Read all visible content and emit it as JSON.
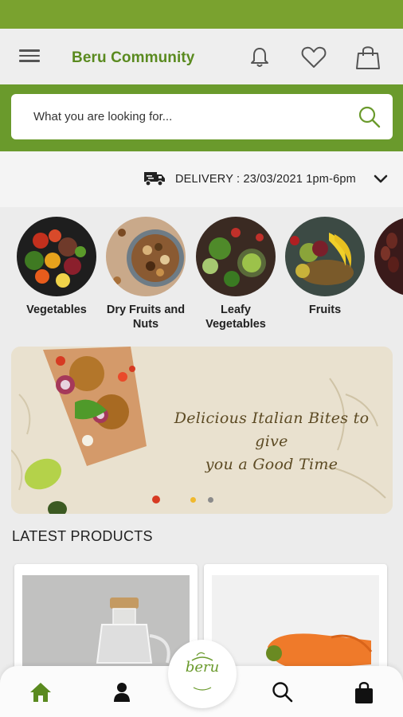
{
  "header": {
    "title": "Beru Community",
    "icons": [
      "menu-icon",
      "bell-icon",
      "heart-icon",
      "bag-icon"
    ]
  },
  "search": {
    "placeholder": "What you are looking for..."
  },
  "delivery": {
    "text": "DELIVERY : 23/03/2021 1pm-6pm"
  },
  "categories": [
    {
      "label": "Vegetables"
    },
    {
      "label": "Dry Fruits and Nuts"
    },
    {
      "label": "Leafy Vegetables"
    },
    {
      "label": "Fruits"
    }
  ],
  "banner": {
    "line1": "Delicious Italian Bites to give",
    "line2": "you a Good Time",
    "page_count": 2,
    "active_page": 1
  },
  "latest": {
    "title": "LATEST PRODUCTS"
  },
  "bottom_nav": {
    "items": [
      "home",
      "profile",
      "search",
      "cart"
    ],
    "logo_text": "beru"
  },
  "colors": {
    "brand_green": "#7aa22f",
    "title_green": "#5a8a1f",
    "dot_active": "#f0b92e"
  }
}
